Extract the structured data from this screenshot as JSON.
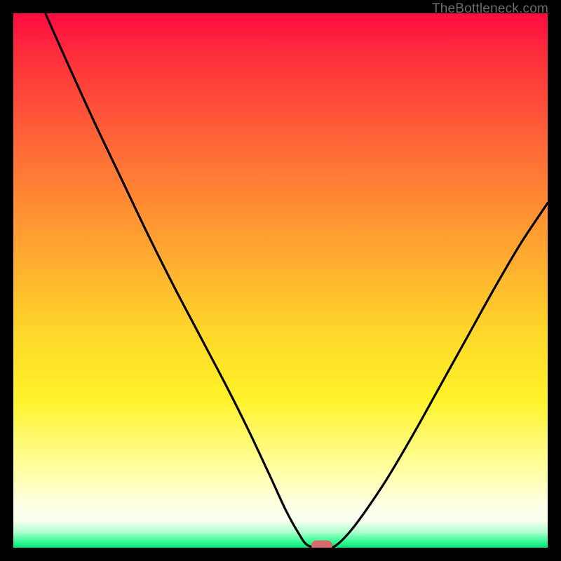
{
  "attribution": "TheBottleneck.com",
  "colors": {
    "frame_bg": "#000000",
    "curve": "#000000",
    "marker": "#d76a6a",
    "attribution_text": "#6d6d6d"
  },
  "chart_data": {
    "type": "line",
    "title": "",
    "xlabel": "",
    "ylabel": "",
    "xlim": [
      0,
      100
    ],
    "ylim": [
      0,
      100
    ],
    "annotations": [
      {
        "text": "TheBottleneck.com",
        "position": "top-right"
      }
    ],
    "series": [
      {
        "name": "bottleneck-curve",
        "xy": [
          [
            6,
            100
          ],
          [
            10,
            91
          ],
          [
            15,
            80
          ],
          [
            20,
            69.5
          ],
          [
            25,
            59
          ],
          [
            30,
            49
          ],
          [
            35,
            39.5
          ],
          [
            40,
            30
          ],
          [
            44,
            22
          ],
          [
            48,
            13.5
          ],
          [
            51,
            7
          ],
          [
            53.5,
            2.5
          ],
          [
            55,
            0.5
          ],
          [
            57,
            0
          ],
          [
            59,
            0
          ],
          [
            60.5,
            0.5
          ],
          [
            63,
            3
          ],
          [
            66,
            7
          ],
          [
            70,
            13
          ],
          [
            75,
            21.5
          ],
          [
            80,
            30.5
          ],
          [
            85,
            39.5
          ],
          [
            90,
            48.5
          ],
          [
            95,
            57
          ],
          [
            100,
            64.5
          ]
        ]
      }
    ],
    "marker": {
      "name": "optimal-point",
      "x": 57.8,
      "y": 0.4
    }
  }
}
